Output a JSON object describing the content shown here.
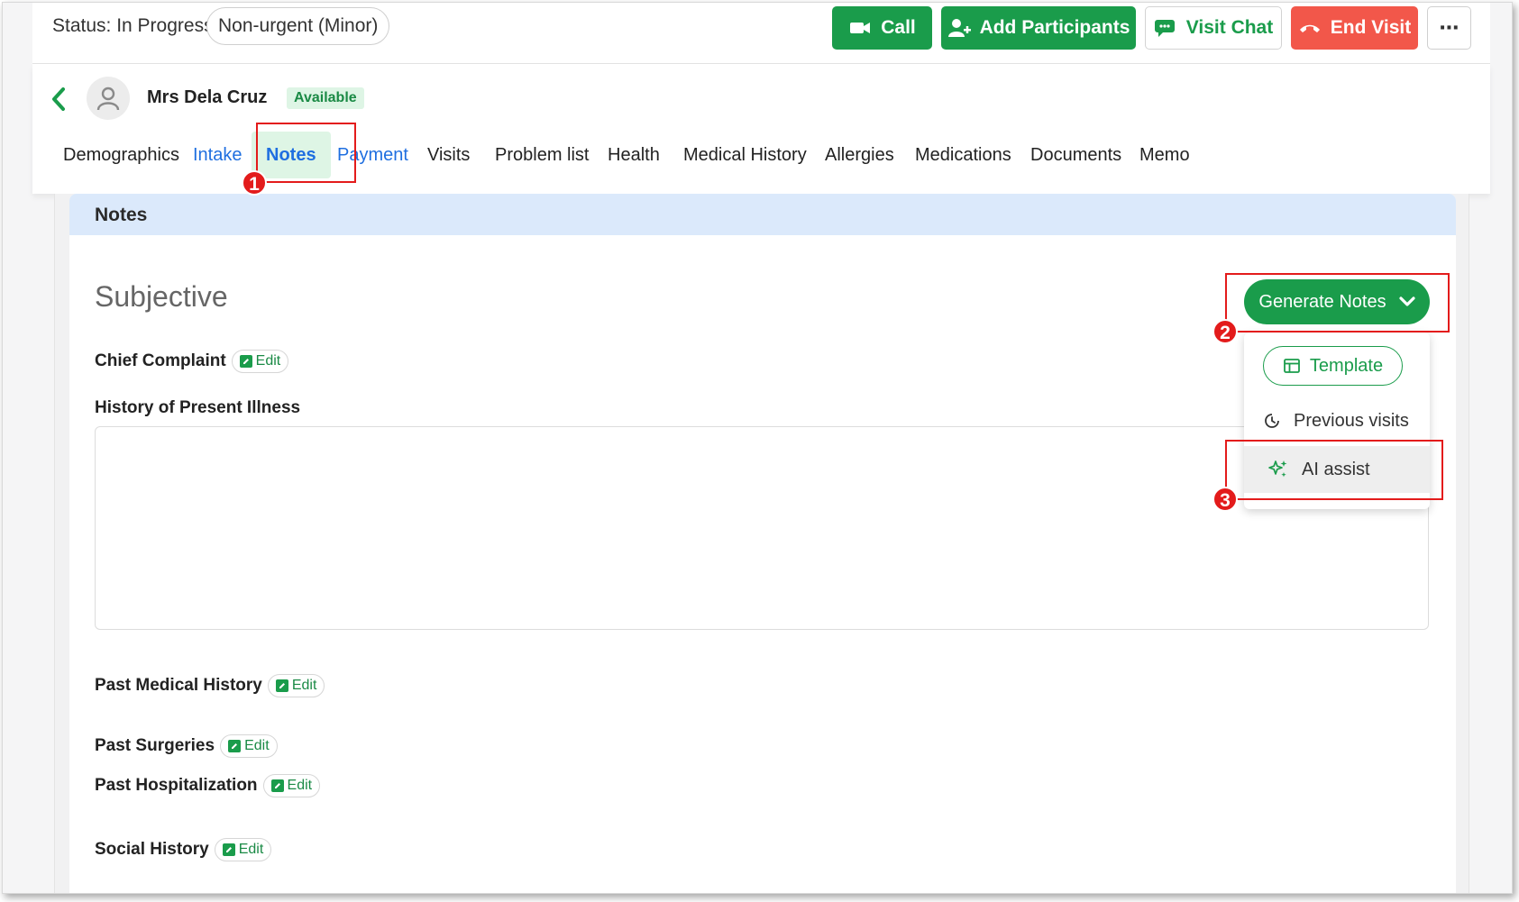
{
  "topbar": {
    "status": "Status: In Progress",
    "urgency": "Non-urgent (Minor)",
    "call_label": "Call",
    "add_participants_label": "Add Participants",
    "visit_chat_label": "Visit Chat",
    "end_visit_label": "End Visit",
    "more_label": "⋯"
  },
  "patient": {
    "name": "Mrs Dela Cruz",
    "availability": "Available"
  },
  "tabs": [
    {
      "label": "Demographics"
    },
    {
      "label": "Intake"
    },
    {
      "label": "Notes"
    },
    {
      "label": "Payment"
    },
    {
      "label": "Visits"
    },
    {
      "label": "Problem list"
    },
    {
      "label": "Health"
    },
    {
      "label": "Medical History"
    },
    {
      "label": "Allergies"
    },
    {
      "label": "Medications"
    },
    {
      "label": "Documents"
    },
    {
      "label": "Memo"
    }
  ],
  "notes": {
    "card_title": "Notes",
    "section_title": "Subjective",
    "edit_label": "Edit",
    "fields": {
      "chief_complaint": "Chief Complaint",
      "hpi": "History of Present Illness",
      "past_medical_history": "Past Medical History",
      "past_surgeries": "Past Surgeries",
      "past_hospitalization": "Past Hospitalization",
      "social_history": "Social History"
    }
  },
  "generate": {
    "button_label": "Generate Notes",
    "template_label": "Template",
    "previous_visits_label": "Previous visits",
    "ai_assist_label": "AI assist"
  },
  "annotations": [
    "1",
    "2",
    "3"
  ],
  "colors": {
    "brand_green": "#1a9c4b",
    "danger_red": "#f2574a",
    "link_blue": "#1f6fe0",
    "annotation_red": "#e31b1b"
  }
}
